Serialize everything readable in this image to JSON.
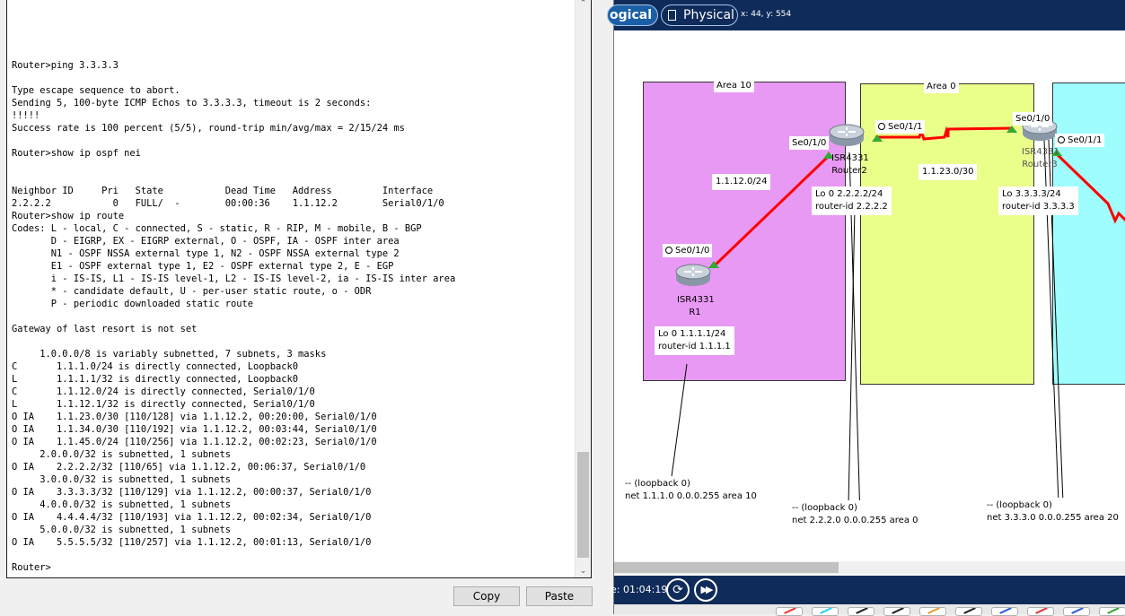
{
  "terminal": {
    "lines": [
      "Router>ping 3.3.3.3",
      "",
      "Type escape sequence to abort.",
      "Sending 5, 100-byte ICMP Echos to 3.3.3.3, timeout is 2 seconds:",
      "!!!!!",
      "Success rate is 100 percent (5/5), round-trip min/avg/max = 2/15/24 ms",
      "",
      "Router>show ip ospf nei",
      "",
      "",
      "Neighbor ID     Pri   State           Dead Time   Address         Interface",
      "2.2.2.2           0   FULL/  -        00:00:36    1.1.12.2        Serial0/1/0",
      "Router>show ip route",
      "Codes: L - local, C - connected, S - static, R - RIP, M - mobile, B - BGP",
      "       D - EIGRP, EX - EIGRP external, O - OSPF, IA - OSPF inter area",
      "       N1 - OSPF NSSA external type 1, N2 - OSPF NSSA external type 2",
      "       E1 - OSPF external type 1, E2 - OSPF external type 2, E - EGP",
      "       i - IS-IS, L1 - IS-IS level-1, L2 - IS-IS level-2, ia - IS-IS inter area",
      "       * - candidate default, U - per-user static route, o - ODR",
      "       P - periodic downloaded static route",
      "",
      "Gateway of last resort is not set",
      "",
      "     1.0.0.0/8 is variably subnetted, 7 subnets, 3 masks",
      "C       1.1.1.0/24 is directly connected, Loopback0",
      "L       1.1.1.1/32 is directly connected, Loopback0",
      "C       1.1.12.0/24 is directly connected, Serial0/1/0",
      "L       1.1.12.1/32 is directly connected, Serial0/1/0",
      "O IA    1.1.23.0/30 [110/128] via 1.1.12.2, 00:20:00, Serial0/1/0",
      "O IA    1.1.34.0/30 [110/192] via 1.1.12.2, 00:03:44, Serial0/1/0",
      "O IA    1.1.45.0/24 [110/256] via 1.1.12.2, 00:02:23, Serial0/1/0",
      "     2.0.0.0/32 is subnetted, 1 subnets",
      "O IA    2.2.2.2/32 [110/65] via 1.1.12.2, 00:06:37, Serial0/1/0",
      "     3.0.0.0/32 is subnetted, 1 subnets",
      "O IA    3.3.3.3/32 [110/129] via 1.1.12.2, 00:00:37, Serial0/1/0",
      "     4.0.0.0/32 is subnetted, 1 subnets",
      "O IA    4.4.4.4/32 [110/193] via 1.1.12.2, 00:02:34, Serial0/1/0",
      "     5.0.0.0/32 is subnetted, 1 subnets",
      "O IA    5.5.5.5/32 [110/257] via 1.1.12.2, 00:01:13, Serial0/1/0",
      "",
      "Router>"
    ],
    "copy_label": "Copy",
    "paste_label": "Paste"
  },
  "workspace": {
    "tab_logical": "ogical",
    "tab_physical": "Physical",
    "coords": "x: 44, y: 554",
    "time_label": "e: 01:04:19",
    "areas": {
      "area10": "Area 10",
      "area0": "Area 0"
    },
    "colors": {
      "area10": "#e899f4",
      "area0": "#eaff8a",
      "area_right": "#9ffdfd",
      "link": "#ff0000",
      "port_up": "#33aa33"
    },
    "r1": {
      "model": "ISR4331",
      "name": "R1",
      "port": "Se0/1/0",
      "info_1": "Lo 0 1.1.1.1/24",
      "info_2": "router-id 1.1.1.1",
      "note_1": "-- (loopback 0)",
      "note_2": "net 1.1.1.0 0.0.0.255 area 10"
    },
    "r2": {
      "model": "ISR4331",
      "name": "Router2",
      "port_left": "Se0/1/0",
      "port_right": "Se0/1/1",
      "info_1": "Lo 0 2.2.2.2/24",
      "info_2": "router-id 2.2.2.2",
      "note_1": "-- (loopback 0)",
      "note_2": "net 2.2.2.0 0.0.0.255 area 0"
    },
    "r3": {
      "model": "ISR4331",
      "name": "Router3",
      "port_left": "Se0/1/0",
      "port_right": "Se0/1/1",
      "info_1": "Lo 3.3.3.3/24",
      "info_2": "router-id 3.3.3.3",
      "note_1": "-- (loopback 0)",
      "note_2": "net 3.3.3.0 0.0.0.255 area 20"
    },
    "subnets": {
      "s12": "1.1.12.0/24",
      "s23": "1.1.23.0/30"
    }
  }
}
